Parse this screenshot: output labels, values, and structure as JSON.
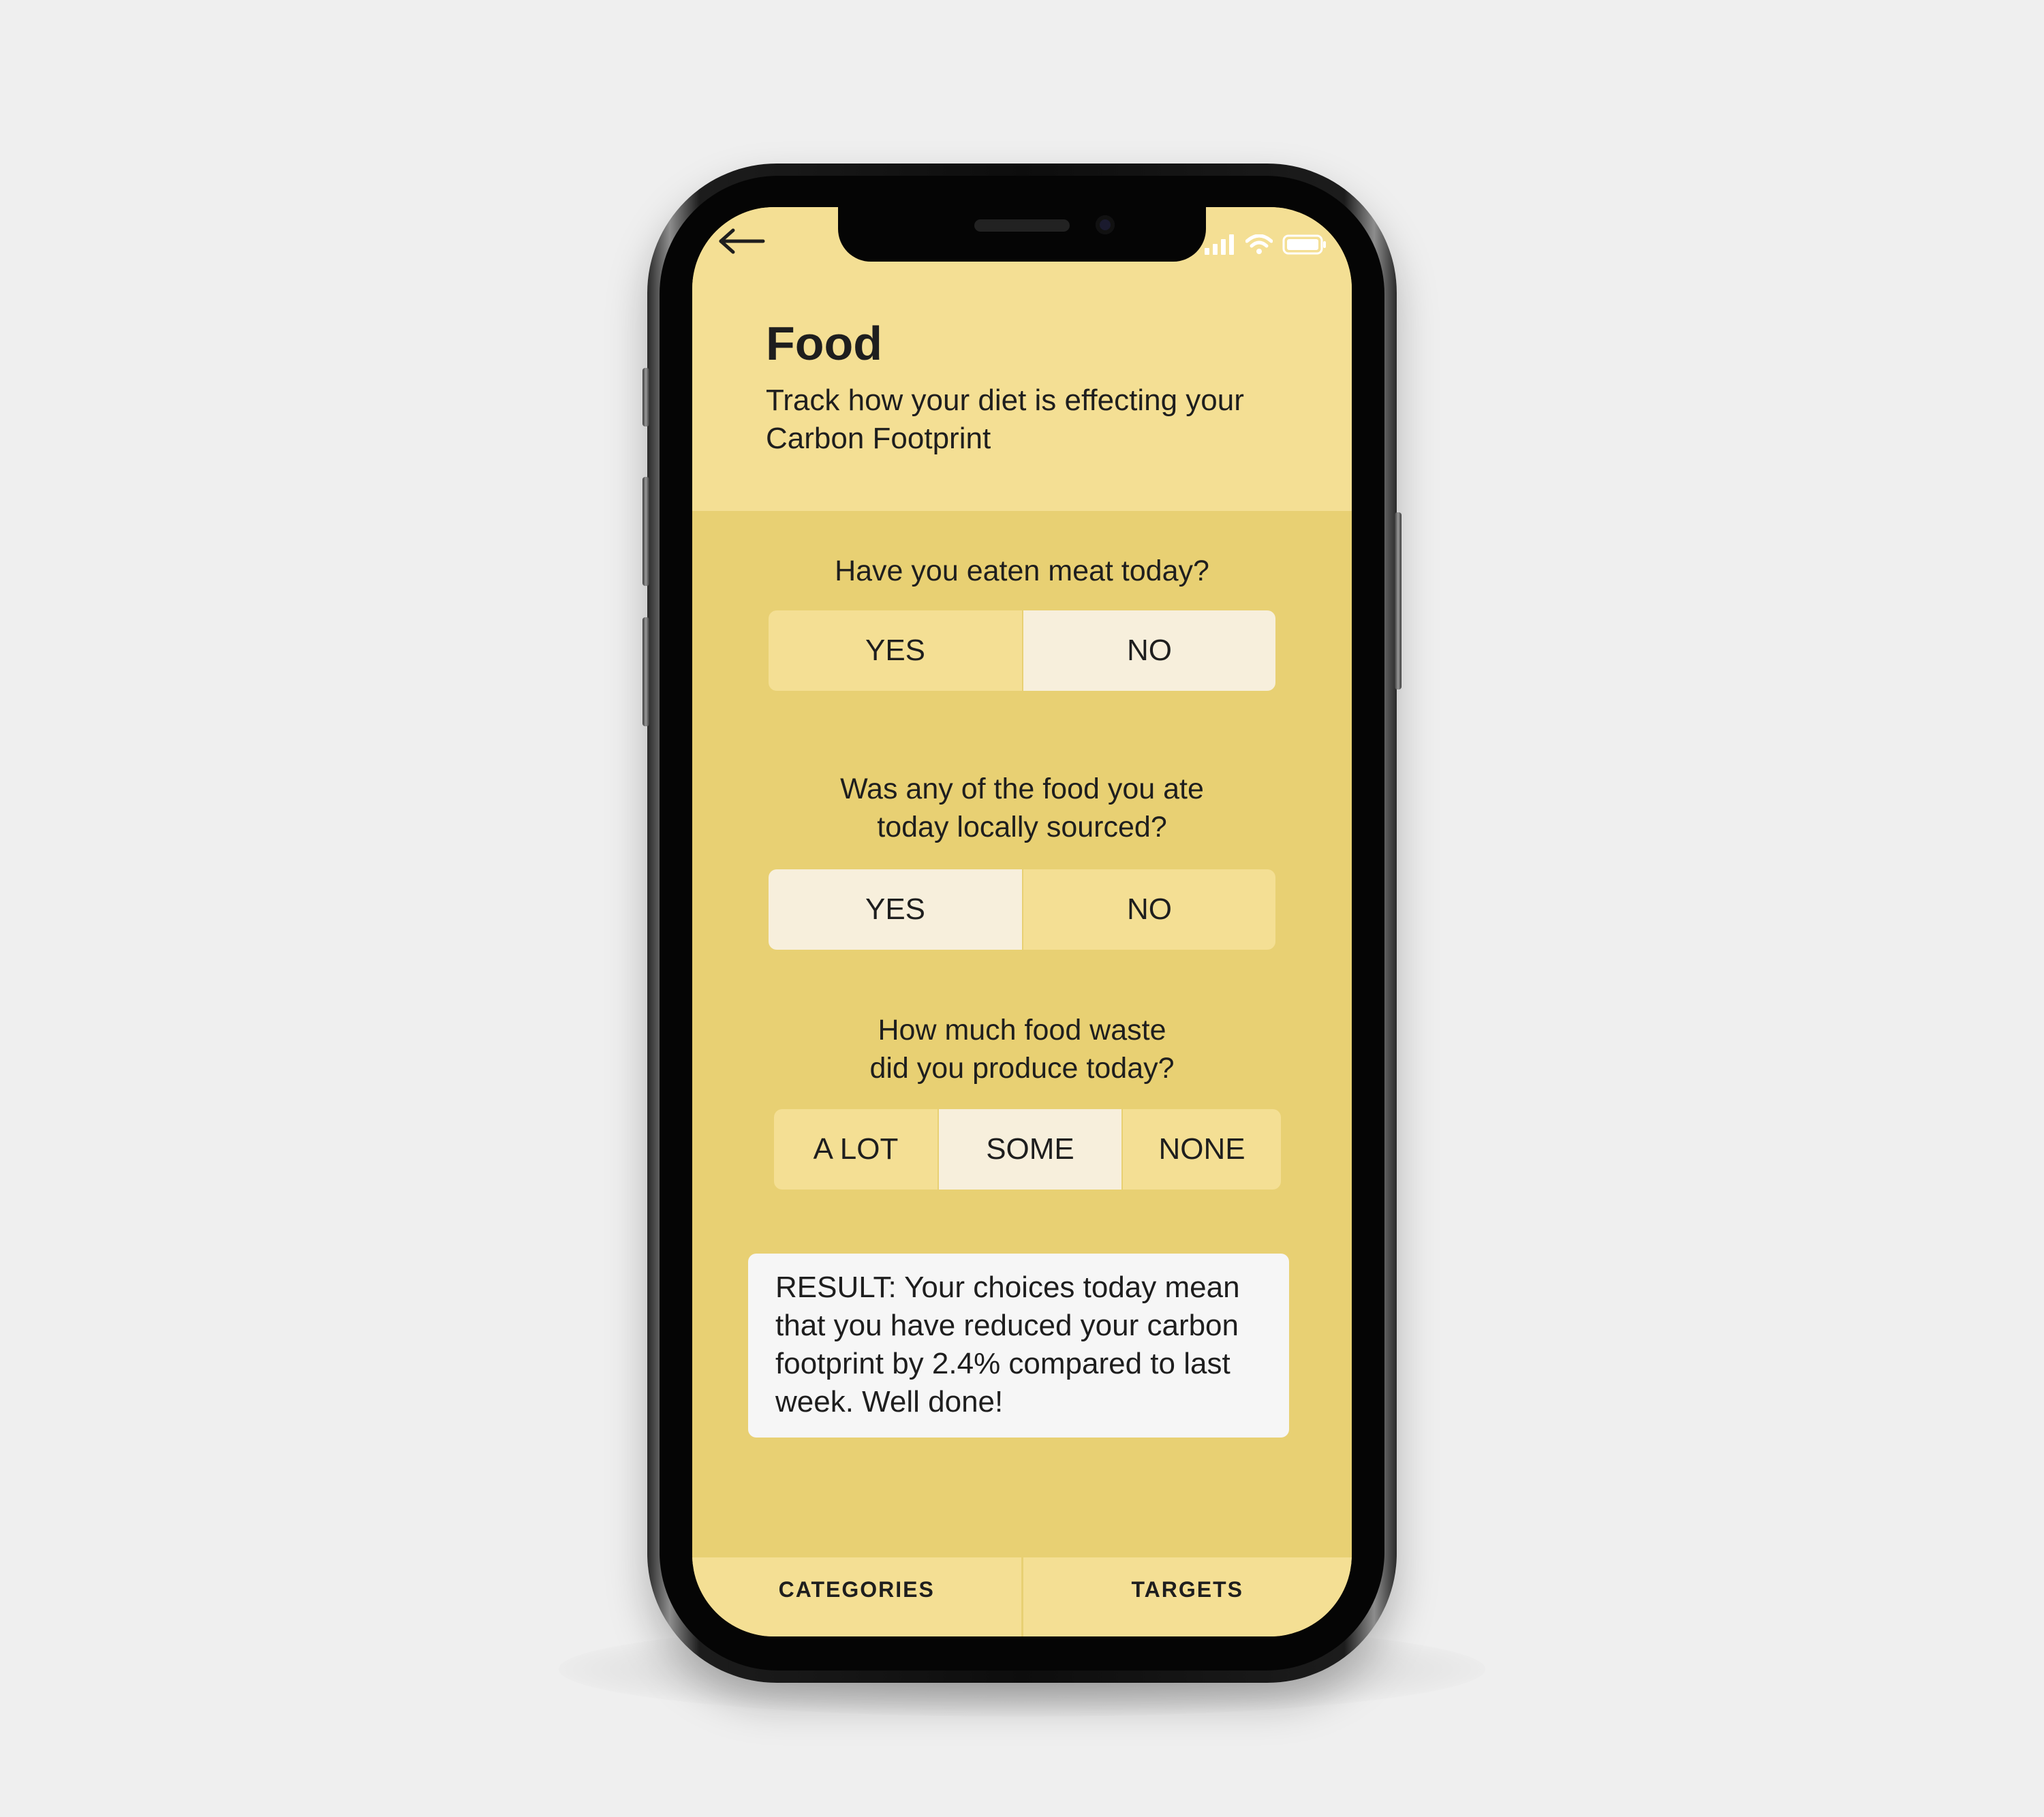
{
  "colors": {
    "header_bg": "#f4df94",
    "body_bg": "#e8d073",
    "selected_bg": "#f7efdc",
    "result_bg": "#f6f6f6",
    "text": "#1e1e1e"
  },
  "icons": {
    "back": "back-arrow-icon",
    "signal": "signal-icon",
    "wifi": "wifi-icon",
    "battery": "battery-icon"
  },
  "header": {
    "title": "Food",
    "subtitle": "Track how your diet is effecting your Carbon Footprint"
  },
  "questions": [
    {
      "text": "Have you eaten meat today?",
      "options": [
        "YES",
        "NO"
      ],
      "selected": "NO"
    },
    {
      "text": "Was any of the food you ate\ntoday locally sourced?",
      "options": [
        "YES",
        "NO"
      ],
      "selected": "YES"
    },
    {
      "text": "How much food waste\ndid you produce today?",
      "options": [
        "A LOT",
        "SOME",
        "NONE"
      ],
      "selected": "SOME"
    }
  ],
  "result": {
    "text": "RESULT:  Your choices today mean that you have reduced your carbon footprint by 2.4% compared to last week. Well done!"
  },
  "tabbar": {
    "categories": "CATEGORIES",
    "targets": "TARGETS"
  }
}
